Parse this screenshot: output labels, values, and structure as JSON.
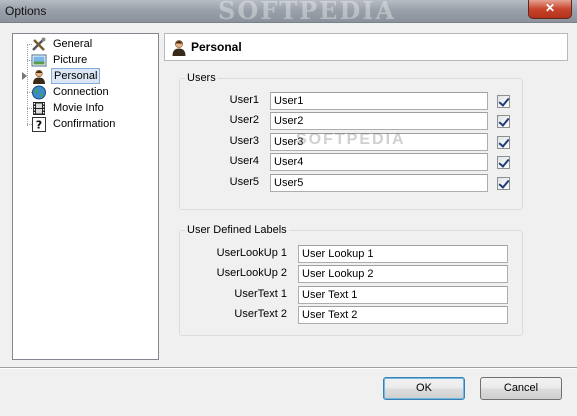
{
  "window": {
    "title": "Options",
    "watermark": "SOFTPEDIA"
  },
  "tree": {
    "items": [
      {
        "label": "General",
        "icon": "tools-icon"
      },
      {
        "label": "Picture",
        "icon": "picture-icon"
      },
      {
        "label": "Personal",
        "icon": "person-icon",
        "selected": true
      },
      {
        "label": "Connection",
        "icon": "globe-icon"
      },
      {
        "label": "Movie Info",
        "icon": "film-icon"
      },
      {
        "label": "Confirmation",
        "icon": "question-icon"
      }
    ]
  },
  "panel": {
    "title": "Personal",
    "users_group": {
      "legend": "Users",
      "rows": [
        {
          "label": "User1",
          "value": "User1",
          "checked": true
        },
        {
          "label": "User2",
          "value": "User2",
          "checked": true
        },
        {
          "label": "User3",
          "value": "User3",
          "checked": true
        },
        {
          "label": "User4",
          "value": "User4",
          "checked": true
        },
        {
          "label": "User5",
          "value": "User5",
          "checked": true
        }
      ]
    },
    "labels_group": {
      "legend": "User Defined Labels",
      "rows": [
        {
          "label": "UserLookUp 1",
          "value": "User Lookup 1"
        },
        {
          "label": "UserLookUp 2",
          "value": "User Lookup 2"
        },
        {
          "label": "UserText 1",
          "value": "User Text 1"
        },
        {
          "label": "UserText 2",
          "value": "User Text 2"
        }
      ]
    }
  },
  "buttons": {
    "ok": "OK",
    "cancel": "Cancel"
  },
  "colors": {
    "selection": "#dce6f4",
    "close": "#c8452c"
  }
}
